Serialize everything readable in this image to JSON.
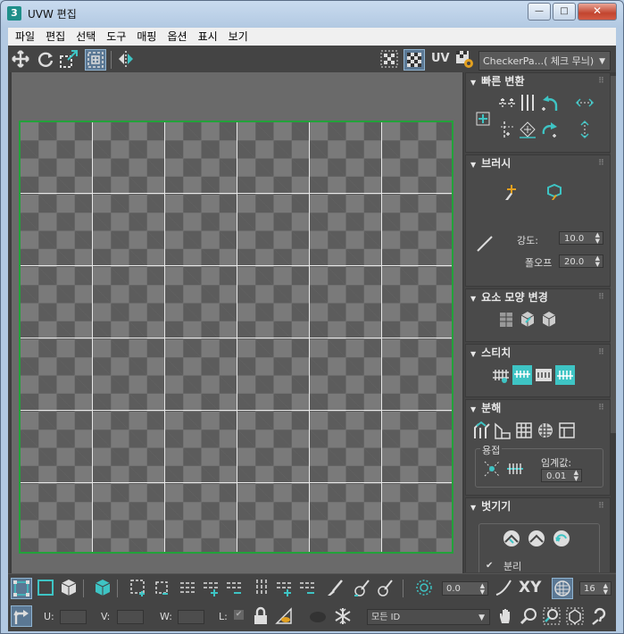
{
  "window": {
    "title": "UVW 편집",
    "app_icon": "3",
    "minimize": "—",
    "maximize": "□",
    "close": "✕"
  },
  "menu": [
    "파일",
    "편집",
    "선택",
    "도구",
    "매핑",
    "옵션",
    "표시",
    "보기"
  ],
  "toolbar": {
    "uv_label": "UV",
    "texture_dropdown": "CheckerPa...( 체크 무늬)"
  },
  "colors": {
    "accent": "#3ec4c4",
    "uv_border": "#22a23a",
    "panel_bg": "#444444"
  },
  "panel": {
    "quick_transform": {
      "title": "빠른 변환"
    },
    "brush": {
      "title": "브러시",
      "strength_label": "강도:",
      "strength_value": "10.0",
      "falloff_label": "폴오프",
      "falloff_value": "20.0"
    },
    "reshape": {
      "title": "요소 모양 변경"
    },
    "stitch": {
      "title": "스티치"
    },
    "explode": {
      "title": "분해",
      "weld_label": "용접",
      "threshold_label": "임계값:",
      "threshold_value": "0.01"
    },
    "peel": {
      "title": "벗기기",
      "detach_label": "분리",
      "detach_checked": true
    }
  },
  "bottom": {
    "spin_value": "0.0",
    "xy_label": "XY",
    "grid_value": "16",
    "u_label": "U:",
    "v_label": "V:",
    "w_label": "W:",
    "l_label": "L:",
    "id_dropdown": "모든 ID"
  }
}
